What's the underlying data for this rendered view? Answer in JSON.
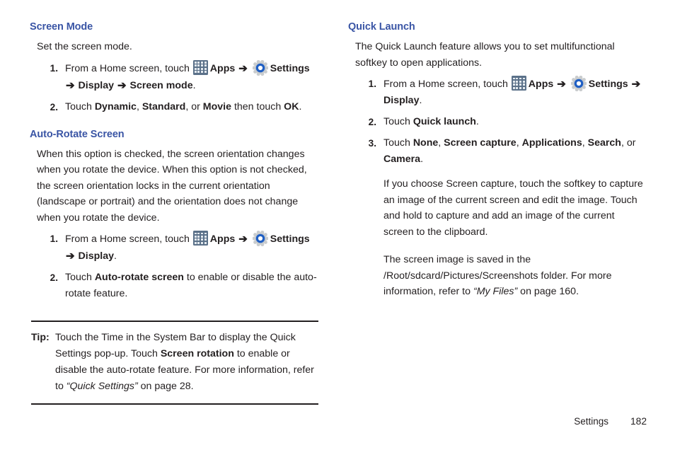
{
  "document": {
    "footer": {
      "section": "Settings",
      "page_number": "182"
    }
  },
  "icons": {
    "apps": "apps-grid-icon",
    "settings": "settings-gear-icon",
    "arrow": "➔"
  },
  "colors": {
    "heading": "#3a55a5",
    "body_text": "#231f20",
    "apps_icon_bg": "#5b7189",
    "apps_icon_cell": "#e2e8ee",
    "gear_ring": "#1f5fc4",
    "gear_body": "#c9ccce"
  },
  "left_column": {
    "sections": [
      {
        "heading": "Screen Mode",
        "intro": "Set the screen mode.",
        "steps": [
          {
            "number": "1.",
            "parts": [
              {
                "t": "From a Home screen, touch ",
                "b": false
              },
              {
                "t": "apps-icon",
                "icon": "apps"
              },
              {
                "t": "Apps ",
                "b": true
              },
              {
                "t": "arrow",
                "icon": "arrow"
              },
              {
                "t": "gear-icon",
                "icon": "gear"
              },
              {
                "t": "Settings",
                "b": true
              },
              {
                "t": " ",
                "b": false
              },
              {
                "t": "arrow",
                "icon": "arrow"
              },
              {
                "t": "Display ",
                "b": true
              },
              {
                "t": "arrow",
                "icon": "arrow"
              },
              {
                "t": "Screen mode",
                "b": true
              },
              {
                "t": ".",
                "b": false
              }
            ]
          },
          {
            "number": "2.",
            "parts": [
              {
                "t": "Touch ",
                "b": false
              },
              {
                "t": "Dynamic",
                "b": true
              },
              {
                "t": ", ",
                "b": false
              },
              {
                "t": "Standard",
                "b": true
              },
              {
                "t": ", or ",
                "b": false
              },
              {
                "t": "Movie",
                "b": true
              },
              {
                "t": " then touch ",
                "b": false
              },
              {
                "t": "OK",
                "b": true
              },
              {
                "t": ".",
                "b": false
              }
            ]
          }
        ]
      },
      {
        "heading": "Auto-Rotate Screen",
        "intro": "When this option is checked, the screen orientation changes when you rotate the device. When this option is not checked, the screen orientation locks in the current orientation (landscape or portrait) and the orientation does not change when you rotate the device.",
        "steps": [
          {
            "number": "1.",
            "parts": [
              {
                "t": "From a Home screen, touch ",
                "b": false
              },
              {
                "t": "apps-icon",
                "icon": "apps"
              },
              {
                "t": "Apps ",
                "b": true
              },
              {
                "t": "arrow",
                "icon": "arrow"
              },
              {
                "t": "gear-icon",
                "icon": "gear"
              },
              {
                "t": "Settings",
                "b": true
              },
              {
                "t": " ",
                "b": false
              },
              {
                "t": "arrow",
                "icon": "arrow"
              },
              {
                "t": "Display",
                "b": true
              },
              {
                "t": ".",
                "b": false
              }
            ]
          },
          {
            "number": "2.",
            "parts": [
              {
                "t": "Touch ",
                "b": false
              },
              {
                "t": "Auto-rotate screen",
                "b": true
              },
              {
                "t": " to enable or disable the auto-rotate feature.",
                "b": false
              }
            ]
          }
        ]
      }
    ],
    "tip": {
      "label": "Tip:",
      "parts": [
        {
          "t": "Touch the Time in the System Bar to display the Quick Settings pop-up. Touch ",
          "b": false
        },
        {
          "t": "Screen rotation",
          "b": true
        },
        {
          "t": " to enable or disable the auto-rotate feature. For more information, refer to ",
          "b": false
        },
        {
          "t": "“Quick Settings”",
          "i": true
        },
        {
          "t": " on page 28.",
          "b": false
        }
      ]
    }
  },
  "right_column": {
    "sections": [
      {
        "heading": "Quick Launch",
        "intro": "The Quick Launch feature allows you to set multifunctional softkey to open applications.",
        "steps": [
          {
            "number": "1.",
            "parts": [
              {
                "t": "From a Home screen, touch ",
                "b": false
              },
              {
                "t": "apps-icon",
                "icon": "apps"
              },
              {
                "t": "Apps ",
                "b": true
              },
              {
                "t": "arrow",
                "icon": "arrow"
              },
              {
                "t": "gear-icon",
                "icon": "gear"
              },
              {
                "t": "Settings",
                "b": true
              },
              {
                "t": " ",
                "b": false
              },
              {
                "t": "arrow",
                "icon": "arrow"
              },
              {
                "t": "Display",
                "b": true
              },
              {
                "t": ".",
                "b": false
              }
            ]
          },
          {
            "number": "2.",
            "parts": [
              {
                "t": "Touch ",
                "b": false
              },
              {
                "t": "Quick launch",
                "b": true
              },
              {
                "t": ".",
                "b": false
              }
            ]
          },
          {
            "number": "3.",
            "parts": [
              {
                "t": "Touch ",
                "b": false
              },
              {
                "t": "None",
                "b": true
              },
              {
                "t": ", ",
                "b": false
              },
              {
                "t": "Screen capture",
                "b": true
              },
              {
                "t": ", ",
                "b": false
              },
              {
                "t": "Applications",
                "b": true
              },
              {
                "t": ", ",
                "b": false
              },
              {
                "t": "Search",
                "b": true
              },
              {
                "t": ", or ",
                "b": false
              },
              {
                "t": "Camera",
                "b": true
              },
              {
                "t": ".",
                "b": false
              }
            ],
            "sub_paragraphs": [
              {
                "parts": [
                  {
                    "t": "If you choose Screen capture, touch the softkey to capture an image of the current screen and edit the image. Touch and hold to capture and add an image of the current screen to the clipboard.",
                    "b": false
                  }
                ]
              },
              {
                "spaced": true,
                "parts": [
                  {
                    "t": "The screen image is saved in the /Root/sdcard/Pictures/Screenshots folder. For more information, refer to ",
                    "b": false
                  },
                  {
                    "t": "“My Files”",
                    "i": true
                  },
                  {
                    "t": " on page 160.",
                    "b": false
                  }
                ]
              }
            ]
          }
        ]
      }
    ]
  }
}
